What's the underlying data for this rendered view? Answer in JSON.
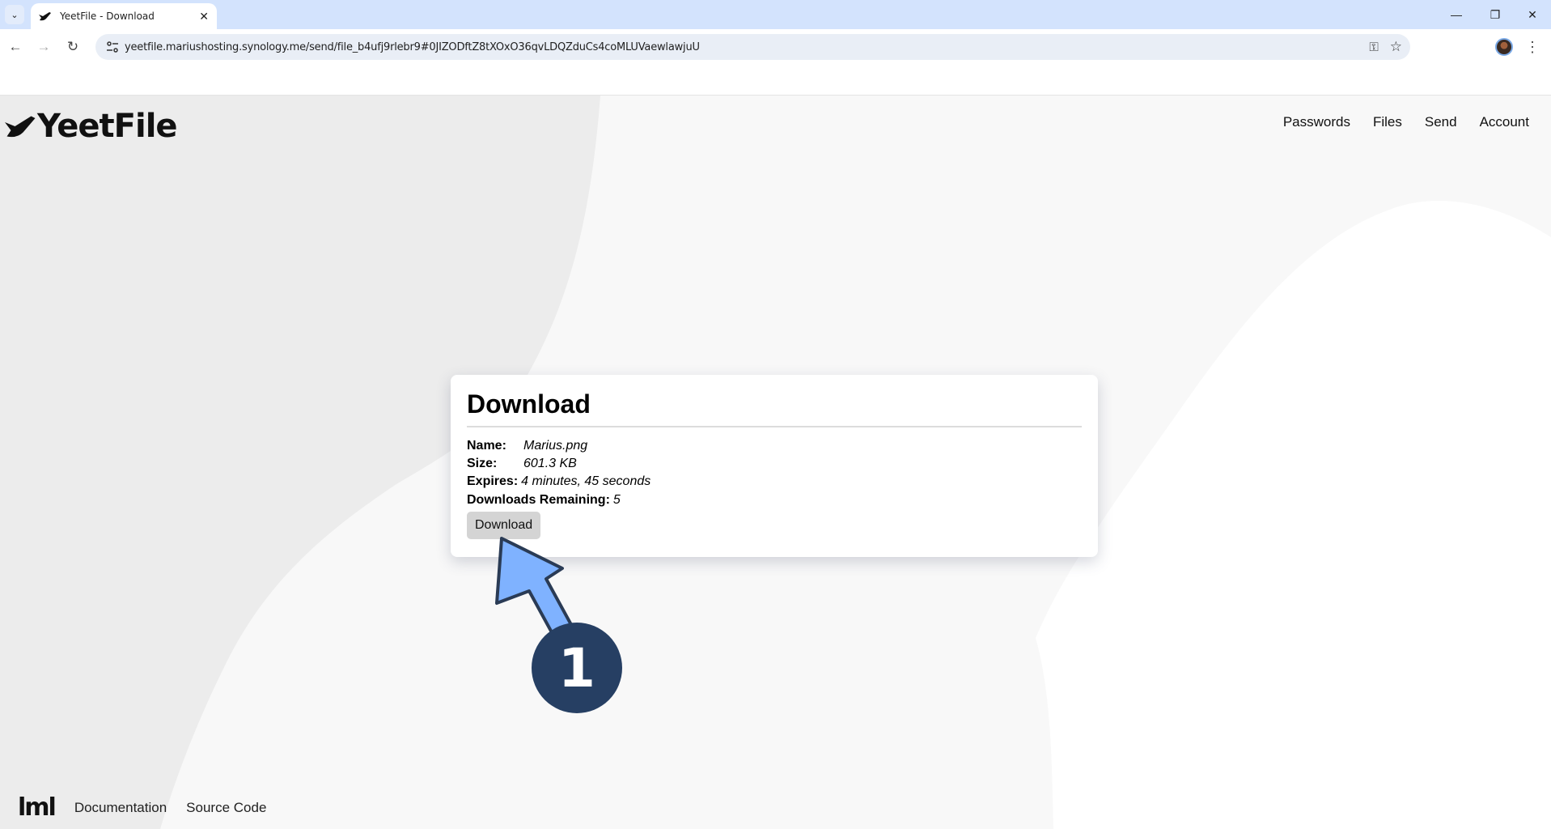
{
  "browser": {
    "tab_title": "YeetFile - Download",
    "url": "yeetfile.mariushosting.synology.me/send/file_b4ufj9rlebr9#0JIZODftZ8tXOxO36qvLDQZduCs4coMLUVaewlawjuU",
    "icons": {
      "tab_menu": "chevron-down-icon",
      "close_tab": "close-icon",
      "back": "arrow-left-icon",
      "forward": "arrow-right-icon",
      "reload": "reload-icon",
      "site_info": "tune-icon",
      "password": "key-icon",
      "bookmark": "star-icon",
      "menu": "kebab-icon"
    }
  },
  "header": {
    "logo_text": "YeetFile",
    "nav": [
      "Passwords",
      "Files",
      "Send",
      "Account"
    ]
  },
  "card": {
    "title": "Download",
    "details": [
      {
        "label": "Name:",
        "value": "Marius.png"
      },
      {
        "label": "Size:",
        "value": "601.3 KB"
      },
      {
        "label": "Expires:",
        "value": "4 minutes, 45 seconds"
      },
      {
        "label": "Downloads Remaining:",
        "value": "5"
      }
    ],
    "button_label": "Download"
  },
  "footer": {
    "logo_text": "lml",
    "links": [
      "Documentation",
      "Source Code"
    ]
  },
  "annotation": {
    "step_number": "1",
    "arrow_color": "#7fb2ff",
    "badge_color": "#263f63"
  },
  "colors": {
    "tabbar": "#d3e3fd",
    "page_bg": "#f8f8f8",
    "bg_shape_dark": "#ececec",
    "bg_shape_light": "#ffffff",
    "button_bg": "#d4d4d4"
  }
}
